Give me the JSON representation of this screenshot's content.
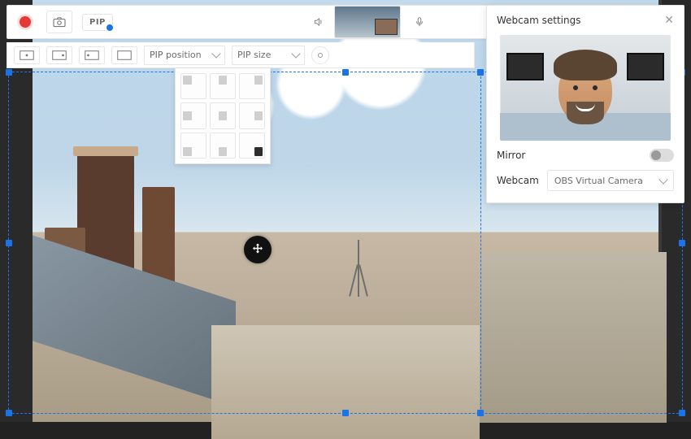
{
  "toolbar": {
    "pip_chip": "PIP",
    "pip_position_label": "PIP position",
    "pip_size_label": "PIP size"
  },
  "panel": {
    "title": "Webcam settings",
    "mirror_label": "Mirror",
    "mirror_on": false,
    "webcam_label": "Webcam",
    "webcam_selected": "OBS Virtual Camera"
  },
  "pip_grid": {
    "selected_index": 8,
    "positions": [
      "top-left",
      "top-center",
      "top-right",
      "middle-left",
      "middle-center",
      "middle-right",
      "bottom-left",
      "bottom-center",
      "bottom-right"
    ]
  },
  "colors": {
    "accent": "#1a73e8",
    "record": "#e53935"
  }
}
